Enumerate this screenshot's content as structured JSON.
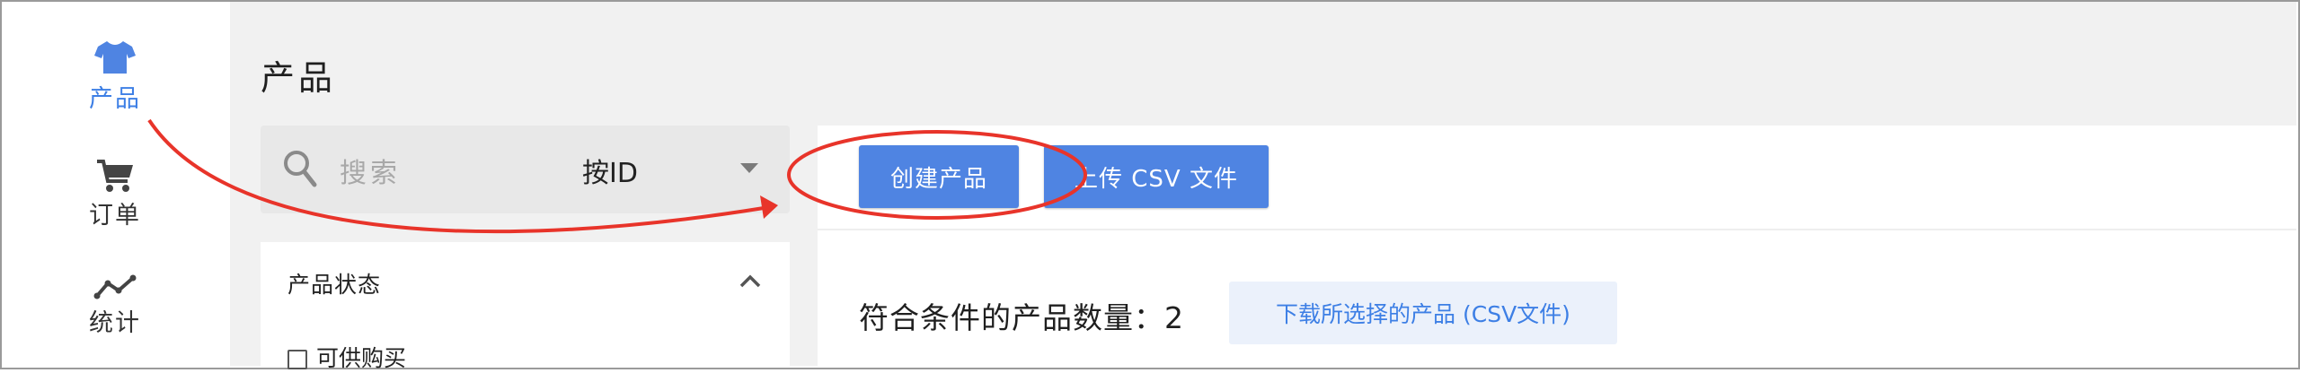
{
  "nav": {
    "products_label": "产品",
    "orders_label": "订单",
    "stats_label": "统计"
  },
  "page": {
    "title": "产品"
  },
  "search": {
    "placeholder": "搜索",
    "mode_label": "按ID"
  },
  "filter": {
    "title": "产品状态",
    "option_available": "可供购买"
  },
  "toolbar": {
    "create_label": "创建产品",
    "upload_label": "上传 CSV 文件"
  },
  "results": {
    "count_label": "符合条件的产品数量：",
    "count_value": "2",
    "download_label": "下载所选择的产品 (CSV文件)"
  },
  "colors": {
    "accent": "#4f84e2",
    "nav_active": "#3d7fe5",
    "annotation": "#e8342a"
  },
  "icons": [
    "tshirt-icon",
    "cart-icon",
    "chart-line-icon",
    "search-icon",
    "caret-down-icon",
    "chevron-up-icon"
  ]
}
